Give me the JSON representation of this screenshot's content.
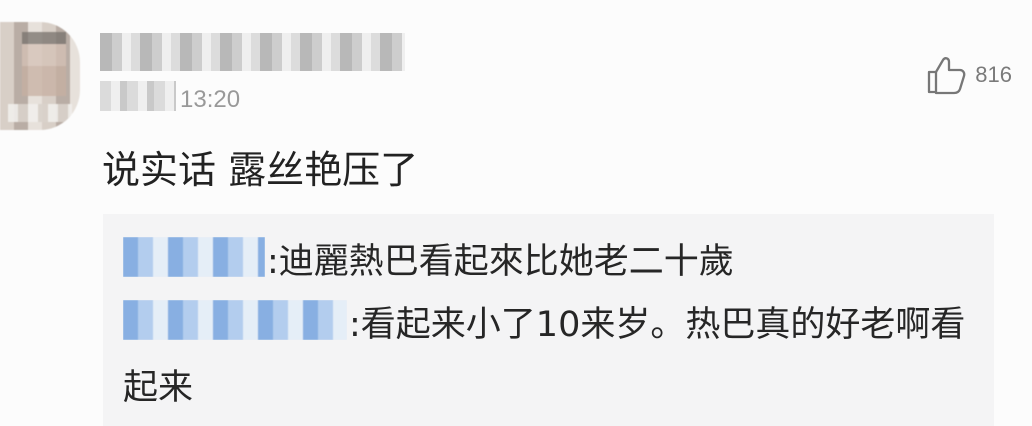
{
  "comment": {
    "username": "",
    "time": "13:20",
    "like_count": "816",
    "text": "说实话 露丝艳压了"
  },
  "replies": [
    {
      "name": "",
      "separator": ":",
      "text": "迪麗熱巴看起來比她老二十歲"
    },
    {
      "name": "",
      "separator": ":",
      "text_line_1": "看起来小了10来岁。热巴真的好老啊看",
      "text_line_2": "起来"
    }
  ],
  "icons": {
    "like": "thumbs-up-icon"
  },
  "colors": {
    "background": "#fcfcfc",
    "reply_background": "#f4f4f5",
    "primary_text": "#222222",
    "secondary_text": "#999999",
    "name_blue": "#4a7fdc"
  }
}
